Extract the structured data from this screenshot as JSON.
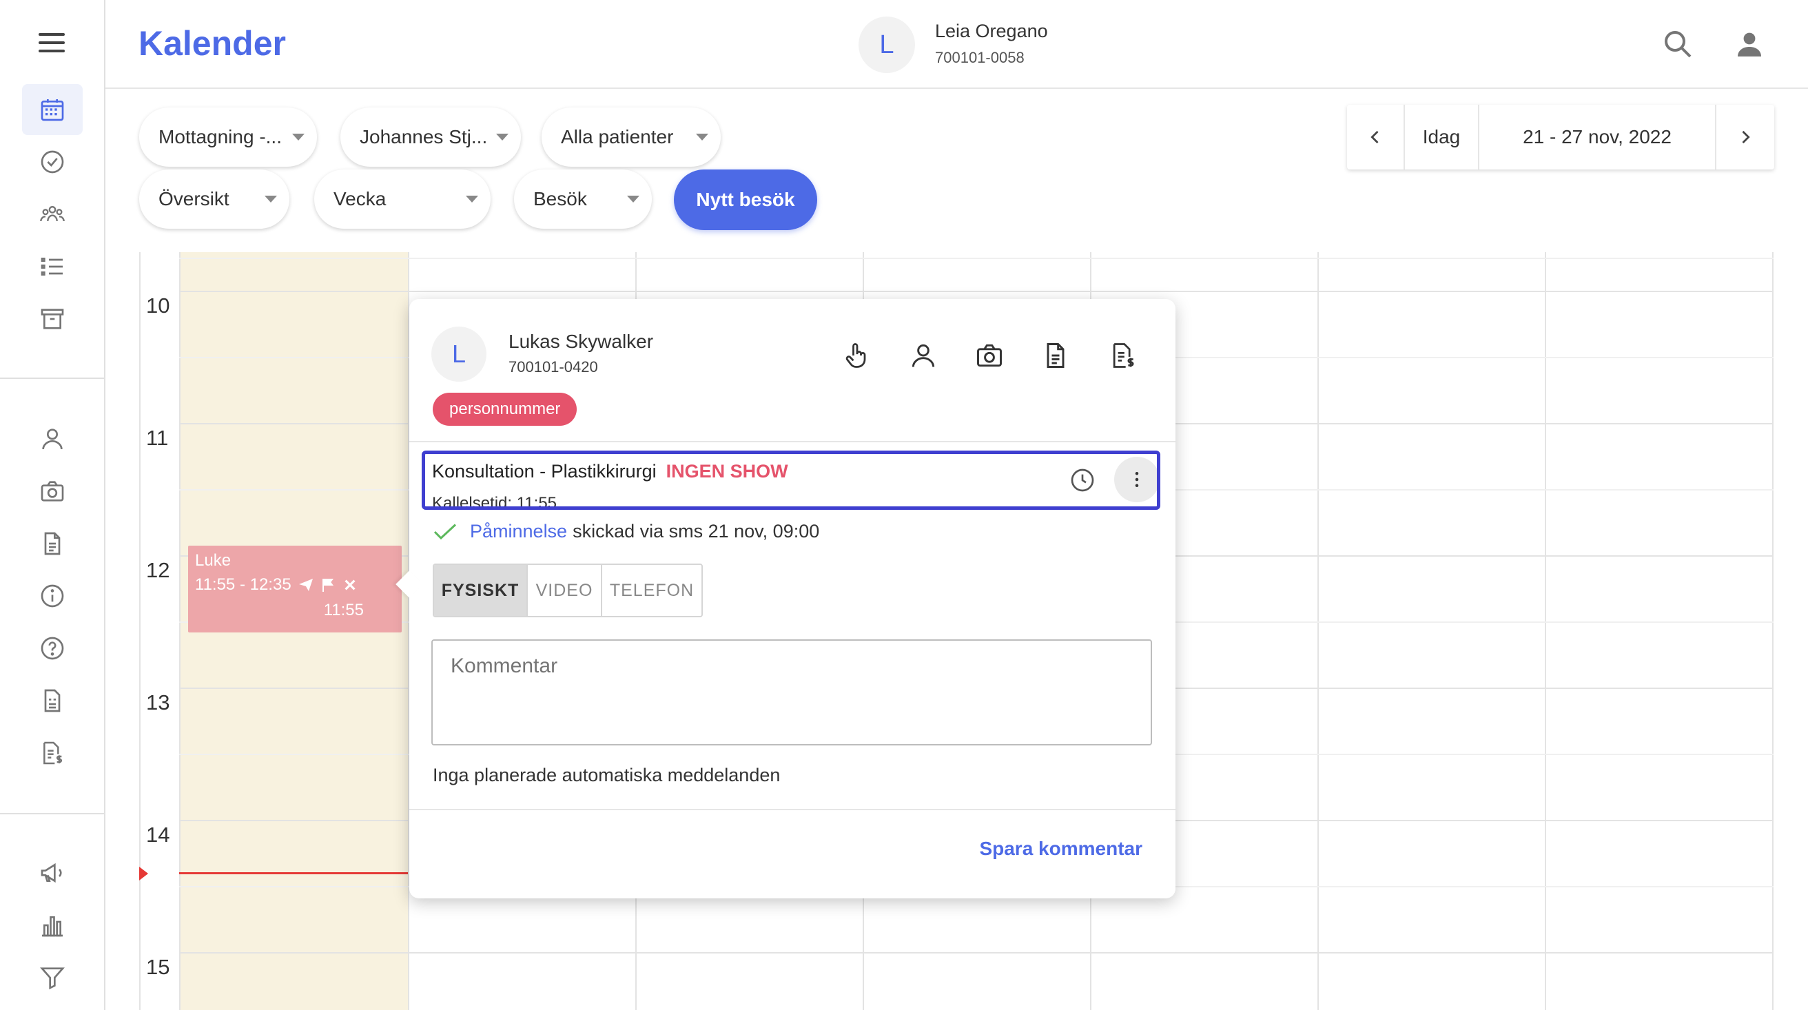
{
  "header": {
    "title": "Kalender",
    "user": {
      "initial": "L",
      "name": "Leia Oregano",
      "id": "700101-0058"
    }
  },
  "filters": {
    "row1": [
      "Mottagning -...",
      "Johannes Stj...",
      "Alla patienter"
    ],
    "row2": [
      "Översikt",
      "Vecka",
      "Besök"
    ],
    "new_visit": "Nytt besök"
  },
  "date_nav": {
    "today": "Idag",
    "range": "21 - 27 nov, 2022"
  },
  "calendar": {
    "hours": [
      "10",
      "11",
      "12",
      "13",
      "14",
      "15"
    ],
    "event": {
      "title": "Luke",
      "time": "11:55 - 12:35",
      "call_time": "11:55"
    }
  },
  "popup": {
    "initial": "L",
    "patient_name": "Lukas Skywalker",
    "patient_id": "700101-0420",
    "tag": "personnummer",
    "visit_title": "Konsultation - Plastikkirurgi",
    "visit_status": "INGEN SHOW",
    "visit_sub": "Kallelsetid: 11:55",
    "reminder_link": "Påminnelse",
    "reminder_text": "skickad via sms 21 nov, 09:00",
    "modes": [
      "FYSISKT",
      "VIDEO",
      "TELEFON"
    ],
    "comment_placeholder": "Kommentar",
    "no_messages": "Inga planerade automatiska meddelanden",
    "save": "Spara kommentar"
  },
  "colors": {
    "accent": "#4d6ae6",
    "status": "#e5536b",
    "event": "#eda6a9",
    "today_column": "#f8f2df",
    "now_line": "#e53935",
    "highlight_border": "#3f3fd0"
  }
}
